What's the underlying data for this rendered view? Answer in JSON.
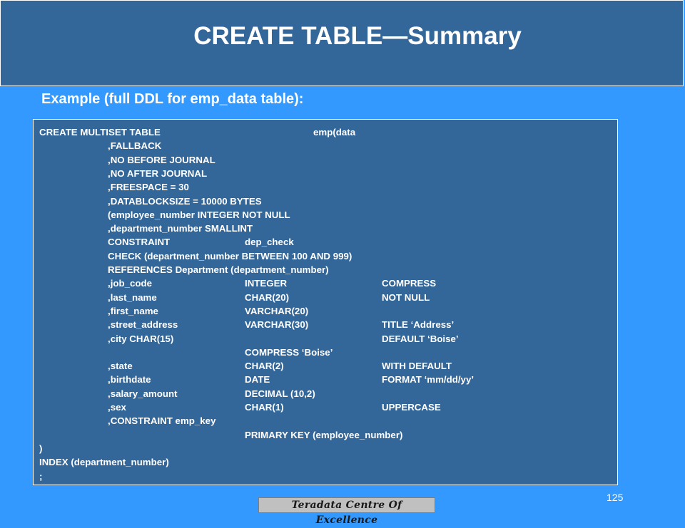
{
  "slide": {
    "title": "CREATE TABLE—Summary",
    "subtitle": "Example (full DDL for emp_data table):",
    "page_number": "125",
    "footer_badge": "Teradata Centre Of Excellence"
  },
  "code": {
    "lines": [
      [
        "CREATE MULTISET TABLE",
        "",
        "",
        "emp(data",
        ""
      ],
      [
        "",
        ",FALLBACK",
        "",
        "",
        ""
      ],
      [
        "",
        ",NO BEFORE JOURNAL",
        "",
        "",
        ""
      ],
      [
        "",
        ",NO AFTER JOURNAL",
        "",
        "",
        ""
      ],
      [
        "",
        ",FREESPACE = 30",
        "",
        "",
        ""
      ],
      [
        "",
        ",DATABLOCKSIZE = 10000 BYTES",
        "",
        "",
        ""
      ],
      [
        "",
        "(employee_number INTEGER NOT NULL",
        "",
        "",
        ""
      ],
      [
        "",
        ",department_number SMALLINT",
        "",
        "",
        ""
      ],
      [
        "",
        "CONSTRAINT",
        "dep_check",
        "",
        ""
      ],
      [
        "",
        "CHECK (department_number BETWEEN 100 AND 999)",
        "",
        "",
        ""
      ],
      [
        "",
        "REFERENCES Department (department_number)",
        "",
        "",
        ""
      ],
      [
        "",
        ",job_code",
        "INTEGER",
        "",
        "COMPRESS"
      ],
      [
        "",
        ",last_name",
        "CHAR(20)",
        "",
        "NOT NULL"
      ],
      [
        "",
        ",first_name",
        "VARCHAR(20)",
        "",
        ""
      ],
      [
        "",
        ",street_address",
        "VARCHAR(30)",
        "",
        "TITLE ‘Address’"
      ],
      [
        "",
        ",city CHAR(15)",
        "",
        "",
        "DEFAULT ‘Boise’"
      ],
      [
        "",
        "",
        "COMPRESS ‘Boise’",
        "",
        ""
      ],
      [
        "",
        ",state",
        "CHAR(2)",
        "",
        "WITH DEFAULT"
      ],
      [
        "",
        ",birthdate",
        "DATE",
        "",
        "FORMAT ‘mm/dd/yy’"
      ],
      [
        "",
        ",salary_amount",
        "DECIMAL (10,2)",
        "",
        ""
      ],
      [
        "",
        ",sex",
        "CHAR(1)",
        "",
        "UPPERCASE"
      ],
      [
        "",
        ",CONSTRAINT emp_key",
        "",
        "",
        ""
      ],
      [
        "",
        "",
        "PRIMARY KEY (employee_number)",
        "",
        ""
      ],
      [
        ")",
        "",
        "",
        "",
        ""
      ],
      [
        "INDEX (department_number)",
        "",
        "",
        "",
        ""
      ],
      [
        ";",
        "",
        "",
        "",
        ""
      ]
    ]
  }
}
